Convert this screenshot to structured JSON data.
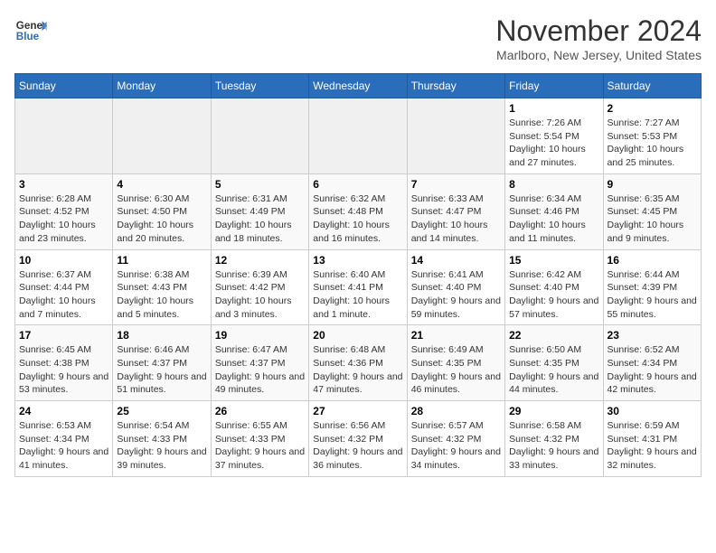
{
  "header": {
    "logo_line1": "General",
    "logo_line2": "Blue",
    "month_title": "November 2024",
    "location": "Marlboro, New Jersey, United States"
  },
  "days_of_week": [
    "Sunday",
    "Monday",
    "Tuesday",
    "Wednesday",
    "Thursday",
    "Friday",
    "Saturday"
  ],
  "weeks": [
    [
      {
        "day": "",
        "info": ""
      },
      {
        "day": "",
        "info": ""
      },
      {
        "day": "",
        "info": ""
      },
      {
        "day": "",
        "info": ""
      },
      {
        "day": "",
        "info": ""
      },
      {
        "day": "1",
        "info": "Sunrise: 7:26 AM\nSunset: 5:54 PM\nDaylight: 10 hours and 27 minutes."
      },
      {
        "day": "2",
        "info": "Sunrise: 7:27 AM\nSunset: 5:53 PM\nDaylight: 10 hours and 25 minutes."
      }
    ],
    [
      {
        "day": "3",
        "info": "Sunrise: 6:28 AM\nSunset: 4:52 PM\nDaylight: 10 hours and 23 minutes."
      },
      {
        "day": "4",
        "info": "Sunrise: 6:30 AM\nSunset: 4:50 PM\nDaylight: 10 hours and 20 minutes."
      },
      {
        "day": "5",
        "info": "Sunrise: 6:31 AM\nSunset: 4:49 PM\nDaylight: 10 hours and 18 minutes."
      },
      {
        "day": "6",
        "info": "Sunrise: 6:32 AM\nSunset: 4:48 PM\nDaylight: 10 hours and 16 minutes."
      },
      {
        "day": "7",
        "info": "Sunrise: 6:33 AM\nSunset: 4:47 PM\nDaylight: 10 hours and 14 minutes."
      },
      {
        "day": "8",
        "info": "Sunrise: 6:34 AM\nSunset: 4:46 PM\nDaylight: 10 hours and 11 minutes."
      },
      {
        "day": "9",
        "info": "Sunrise: 6:35 AM\nSunset: 4:45 PM\nDaylight: 10 hours and 9 minutes."
      }
    ],
    [
      {
        "day": "10",
        "info": "Sunrise: 6:37 AM\nSunset: 4:44 PM\nDaylight: 10 hours and 7 minutes."
      },
      {
        "day": "11",
        "info": "Sunrise: 6:38 AM\nSunset: 4:43 PM\nDaylight: 10 hours and 5 minutes."
      },
      {
        "day": "12",
        "info": "Sunrise: 6:39 AM\nSunset: 4:42 PM\nDaylight: 10 hours and 3 minutes."
      },
      {
        "day": "13",
        "info": "Sunrise: 6:40 AM\nSunset: 4:41 PM\nDaylight: 10 hours and 1 minute."
      },
      {
        "day": "14",
        "info": "Sunrise: 6:41 AM\nSunset: 4:40 PM\nDaylight: 9 hours and 59 minutes."
      },
      {
        "day": "15",
        "info": "Sunrise: 6:42 AM\nSunset: 4:40 PM\nDaylight: 9 hours and 57 minutes."
      },
      {
        "day": "16",
        "info": "Sunrise: 6:44 AM\nSunset: 4:39 PM\nDaylight: 9 hours and 55 minutes."
      }
    ],
    [
      {
        "day": "17",
        "info": "Sunrise: 6:45 AM\nSunset: 4:38 PM\nDaylight: 9 hours and 53 minutes."
      },
      {
        "day": "18",
        "info": "Sunrise: 6:46 AM\nSunset: 4:37 PM\nDaylight: 9 hours and 51 minutes."
      },
      {
        "day": "19",
        "info": "Sunrise: 6:47 AM\nSunset: 4:37 PM\nDaylight: 9 hours and 49 minutes."
      },
      {
        "day": "20",
        "info": "Sunrise: 6:48 AM\nSunset: 4:36 PM\nDaylight: 9 hours and 47 minutes."
      },
      {
        "day": "21",
        "info": "Sunrise: 6:49 AM\nSunset: 4:35 PM\nDaylight: 9 hours and 46 minutes."
      },
      {
        "day": "22",
        "info": "Sunrise: 6:50 AM\nSunset: 4:35 PM\nDaylight: 9 hours and 44 minutes."
      },
      {
        "day": "23",
        "info": "Sunrise: 6:52 AM\nSunset: 4:34 PM\nDaylight: 9 hours and 42 minutes."
      }
    ],
    [
      {
        "day": "24",
        "info": "Sunrise: 6:53 AM\nSunset: 4:34 PM\nDaylight: 9 hours and 41 minutes."
      },
      {
        "day": "25",
        "info": "Sunrise: 6:54 AM\nSunset: 4:33 PM\nDaylight: 9 hours and 39 minutes."
      },
      {
        "day": "26",
        "info": "Sunrise: 6:55 AM\nSunset: 4:33 PM\nDaylight: 9 hours and 37 minutes."
      },
      {
        "day": "27",
        "info": "Sunrise: 6:56 AM\nSunset: 4:32 PM\nDaylight: 9 hours and 36 minutes."
      },
      {
        "day": "28",
        "info": "Sunrise: 6:57 AM\nSunset: 4:32 PM\nDaylight: 9 hours and 34 minutes."
      },
      {
        "day": "29",
        "info": "Sunrise: 6:58 AM\nSunset: 4:32 PM\nDaylight: 9 hours and 33 minutes."
      },
      {
        "day": "30",
        "info": "Sunrise: 6:59 AM\nSunset: 4:31 PM\nDaylight: 9 hours and 32 minutes."
      }
    ]
  ]
}
